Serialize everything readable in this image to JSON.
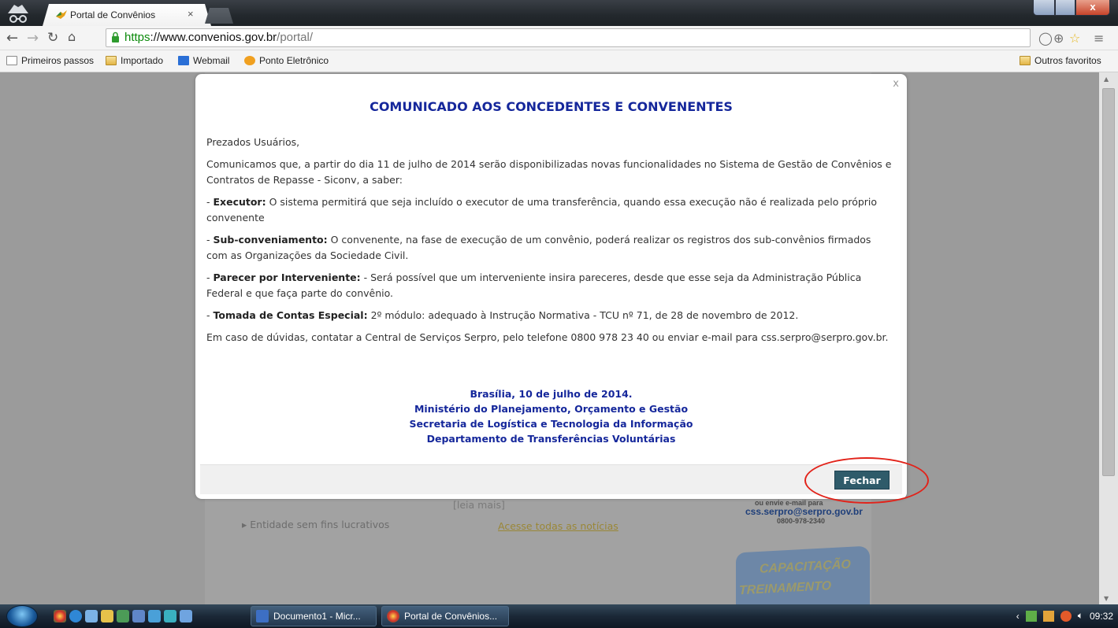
{
  "browser": {
    "tab_title": "Portal de Convênios",
    "tab_close": "×",
    "url_scheme": "https",
    "url_host": "://www.convenios.gov.br",
    "url_path": "/portal/",
    "bookmarks": [
      "Primeiros passos",
      "Importado",
      "Webmail",
      "Ponto Eletrônico"
    ],
    "other_bookmarks": "Outros favoritos"
  },
  "background_page": {
    "leia_mais": "[leia mais]",
    "entidade": "Entidade sem fins lucrativos",
    "todas_noticias": "Acesse todas as notícias",
    "email_hint": "ou envie e-mail para",
    "email": "css.serpro@serpro.gov.br",
    "phone": "0800-978-2340",
    "banner_line1": "CAPACITAÇÃO",
    "banner_line2": "TREINAMENTO"
  },
  "modal": {
    "close_x": "x",
    "title": "COMUNICADO AOS CONCEDENTES E CONVENENTES",
    "greeting": "Prezados Usuários,",
    "intro": "Comunicamos que, a partir do dia 11 de julho de 2014 serão disponibilizadas novas funcionalidades no Sistema de Gestão de Convênios e Contratos de Repasse - Siconv, a saber:",
    "items": [
      {
        "prefix": "- ",
        "label": "Executor:",
        "text": " O sistema permitirá que seja incluído o executor de uma transferência, quando essa execução não é realizada pelo próprio convenente"
      },
      {
        "prefix": "- ",
        "label": "Sub-conveniamento:",
        "text": " O convenente, na fase de execução de um convênio, poderá realizar os registros dos sub-convênios firmados com as Organizações da Sociedade Civil."
      },
      {
        "prefix": "- ",
        "label": "Parecer por Interveniente:",
        "text": " - Será possível que um interveniente insira pareceres, desde que esse seja da Administração Pública Federal e que faça parte do convênio."
      },
      {
        "prefix": "- ",
        "label": "Tomada de Contas Especial:",
        "text": " 2º módulo: adequado à Instrução Normativa - TCU nº 71, de 28 de novembro de 2012."
      }
    ],
    "contact": "Em caso de dúvidas, contatar a Central de Serviços Serpro, pelo telefone 0800 978 23 40 ou enviar e-mail para css.serpro@serpro.gov.br.",
    "signature": [
      "Brasília, 10 de julho de 2014.",
      "Ministério do Planejamento, Orçamento e Gestão",
      "Secretaria de Logística e Tecnologia da Informação",
      "Departamento de Transferências Voluntárias"
    ],
    "close_button": "Fechar",
    "highlight_color": "#e2231a"
  },
  "taskbar": {
    "tasks": [
      "Documento1 - Micr...",
      "Portal de Convênios..."
    ],
    "clock": "09:32"
  }
}
